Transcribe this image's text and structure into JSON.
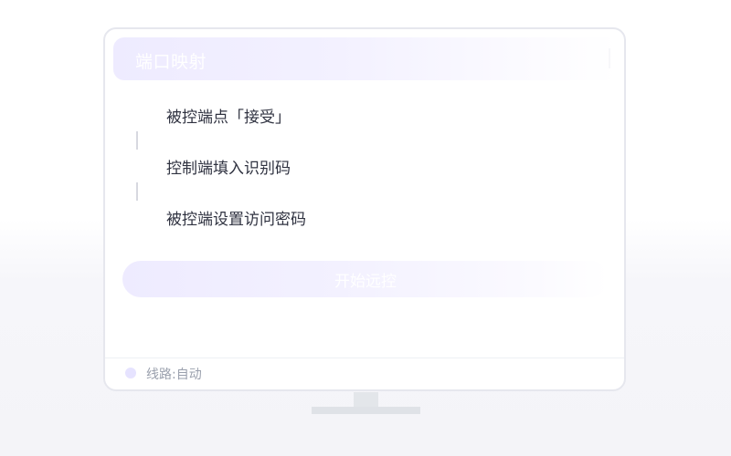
{
  "header": {
    "title": "端口映射"
  },
  "steps": [
    {
      "label": "被控端点「接受」"
    },
    {
      "label": "控制端填入识别码"
    },
    {
      "label": "被控端设置访问密码"
    }
  ],
  "start_button": {
    "label": "开始远控"
  },
  "status": {
    "line_label": "线路:自动"
  },
  "colors": {
    "accent_tint": "#eeebff",
    "status_dot": "#e6e3ff",
    "step_text": "#2f3240",
    "status_text": "#9aa0ad",
    "border": "#e6e7ee",
    "stand": "#e3e6ea"
  },
  "icons": {
    "status_dot": "status-dot-icon"
  }
}
